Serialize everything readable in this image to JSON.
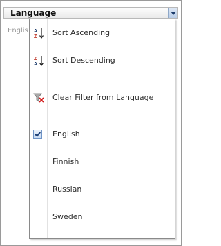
{
  "column": {
    "title": "Language",
    "cell_text": "Englis"
  },
  "menu": {
    "sort_ascending": "Sort Ascending",
    "sort_descending": "Sort Descending",
    "clear_filter": "Clear Filter from Language",
    "filter_values": [
      {
        "label": "English",
        "checked": true
      },
      {
        "label": "Finnish",
        "checked": false
      },
      {
        "label": "Russian",
        "checked": false
      },
      {
        "label": "Sweden",
        "checked": false
      }
    ]
  },
  "icons": {
    "sort_ascending": "sort-a-z-icon",
    "sort_descending": "sort-z-a-icon",
    "clear_filter": "clear-filter-icon",
    "dropdown": "chevron-down-icon",
    "checkbox": "checkbox-checked-icon"
  },
  "colors": {
    "accent": "#1c3f77",
    "menu_border": "#8a8a8a",
    "filter_x": "#d11a1a"
  }
}
